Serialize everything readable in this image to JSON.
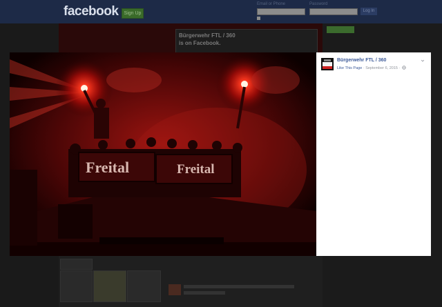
{
  "header": {
    "logo": "facebook",
    "signup_label": "Sign Up",
    "login_email_label": "Email or Phone",
    "login_password_label": "Password",
    "login_button": "Log In"
  },
  "page": {
    "title": "Bürgerwehr FTL / 360",
    "subtitle": "is on Facebook."
  },
  "lightbox": {
    "page_name": "Bürgerwehr FTL / 360",
    "like_page": "Like This Page",
    "separator": "·",
    "date": "September 6, 2015",
    "banner_left": "Freital",
    "banner_right": "Freital"
  },
  "icons": {
    "privacy": "globe-icon",
    "options": "chevron-down-icon"
  },
  "colors": {
    "fb_blue": "#3b5998",
    "meta_gray": "#90949c",
    "flare_red": "#ff2a1a"
  }
}
